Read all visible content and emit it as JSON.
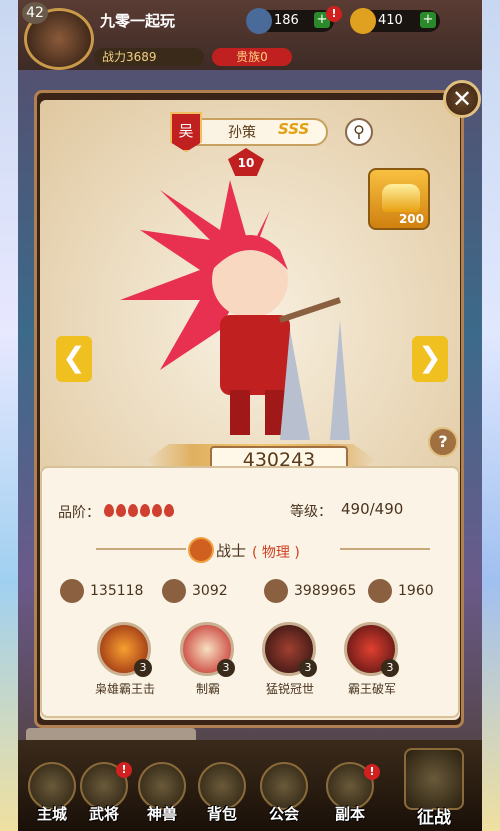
{
  "top": {
    "level": "42",
    "player_name": "九零一起玩",
    "power": "战力3689",
    "noble": "贵族0",
    "res1": "186",
    "res2": "410"
  },
  "panel": {
    "kingdom": "吴",
    "hero_name": "孙策",
    "rank": "SSS",
    "star_level": "10",
    "gold_amount": "200",
    "power_value": "430243",
    "quality_label": "品阶：",
    "level_label": "等级：",
    "level_value": "490/490",
    "class_name": "战士",
    "class_type": "( 物理 )",
    "stats": [
      "135118",
      "3092",
      "3989965",
      "1960"
    ],
    "skills": [
      {
        "name": "枭雄霸王击",
        "level": "3"
      },
      {
        "name": "制霸",
        "level": "3"
      },
      {
        "name": "猛锐冠世",
        "level": "3"
      },
      {
        "name": "霸王破军",
        "level": "3"
      }
    ]
  },
  "nav": [
    "主城",
    "武将",
    "神兽",
    "背包",
    "公会",
    "副本",
    "征战"
  ],
  "colors": {
    "accent": "#c02020",
    "gold": "#f0c020",
    "card": "#fbf4e6"
  }
}
